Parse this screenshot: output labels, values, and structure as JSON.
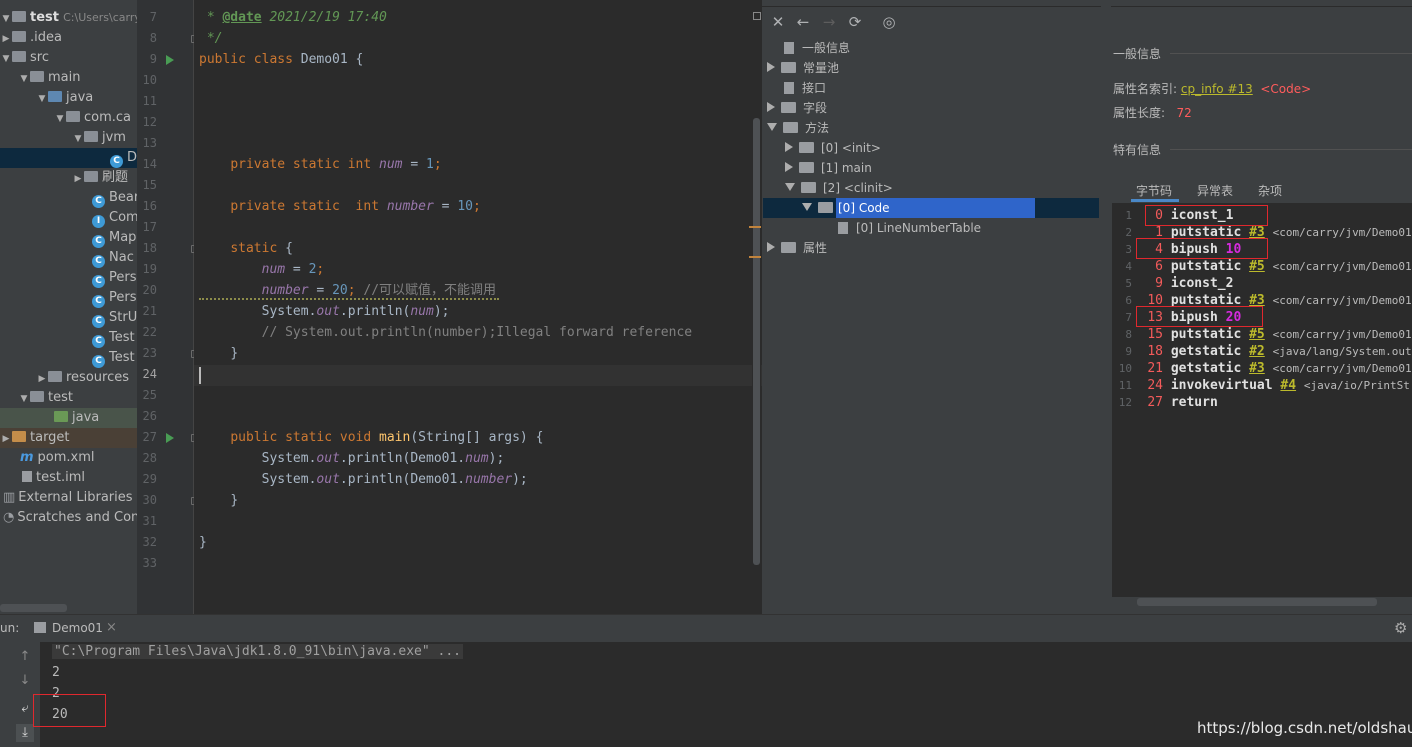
{
  "project": {
    "root_name": "test",
    "root_path": "C:\\Users\\carry.",
    "items": [
      {
        "label": ".idea"
      },
      {
        "label": "src"
      },
      {
        "label": "main"
      },
      {
        "label": "java"
      },
      {
        "label": "com.ca"
      },
      {
        "label": "jvm"
      },
      {
        "label": "D"
      },
      {
        "label": "刷题"
      },
      {
        "label": "Bear"
      },
      {
        "label": "Com"
      },
      {
        "label": "Map"
      },
      {
        "label": "Nac"
      },
      {
        "label": "Pers"
      },
      {
        "label": "Pers"
      },
      {
        "label": "StrU"
      },
      {
        "label": "Test"
      },
      {
        "label": "Test"
      },
      {
        "label": "resources"
      },
      {
        "label": "test"
      },
      {
        "label": "java"
      },
      {
        "label": "target"
      },
      {
        "label": "pom.xml"
      },
      {
        "label": "test.iml"
      },
      {
        "label": "External Libraries"
      },
      {
        "label": "Scratches and Cons"
      }
    ]
  },
  "editor": {
    "line_numbers": [
      "7",
      "8",
      "9",
      "10",
      "11",
      "12",
      "13",
      "14",
      "15",
      "16",
      "17",
      "18",
      "19",
      "20",
      "21",
      "22",
      "23",
      "24",
      "25",
      "26",
      "27",
      "28",
      "29",
      "30",
      "31",
      "32",
      "33"
    ],
    "doc_line1_prefix": " * ",
    "doc_tag": "@date",
    "doc_line1_rest": " 2021/2/19 17:40",
    "doc_line2": " */",
    "class_kw": "public class ",
    "class_name": "Demo01 {",
    "l14_kw": "private static int ",
    "l14_field": "num",
    "l14_eq": " = ",
    "l14_num": "1",
    "l14_end": ";",
    "l16_kw": "private static  int ",
    "l16_field": "number",
    "l16_eq": " = ",
    "l16_num": "10",
    "l16_end": ";",
    "l18_kw": "static",
    "l18_rest": " {",
    "l19_field": "num",
    "l19_eq": " = ",
    "l19_num": "2",
    "l19_end": ";",
    "l20_field": "number",
    "l20_eq": " = ",
    "l20_num": "20",
    "l20_end": "; ",
    "l20_comment": "//可以赋值，不能调用",
    "l21_a": "System.",
    "l21_out": "out",
    "l21_b": ".println(",
    "l21_field": "num",
    "l21_c": ");",
    "l22_comment": "// System.out.println(number);Illegal forward reference",
    "l23": "}",
    "l27_kw": "public static void ",
    "l27_fn": "main",
    "l27_rest": "(String[] args) {",
    "l28_a": "System.",
    "l28_out": "out",
    "l28_b": ".println(Demo01.",
    "l28_field": "num",
    "l28_c": ");",
    "l29_a": "System.",
    "l29_out": "out",
    "l29_b": ".println(Demo01.",
    "l29_field": "number",
    "l29_c": ");",
    "l30": "}",
    "l32": "}"
  },
  "bytecode_viewer": {
    "toolbar": {
      "close": "✕",
      "back": "←",
      "forward": "→",
      "refresh": "⟳",
      "web": "◎"
    },
    "tree": [
      {
        "label": "一般信息"
      },
      {
        "label": "常量池"
      },
      {
        "label": "接口"
      },
      {
        "label": "字段"
      },
      {
        "label": "方法"
      },
      {
        "label": "[0] <init>"
      },
      {
        "label": "[1] main"
      },
      {
        "label": "[2] <clinit>"
      },
      {
        "label": "[0] Code"
      },
      {
        "label": "[0] LineNumberTable"
      },
      {
        "label": "属性"
      }
    ],
    "general_title": "一般信息",
    "attr_name_label": "属性名索引:",
    "attr_name_link": "cp_info #13",
    "attr_name_value": "<Code>",
    "attr_len_label": "属性长度:",
    "attr_len_value": "72",
    "specific_title": "特有信息",
    "tabs": [
      "字节码",
      "异常表",
      "杂项"
    ],
    "code_lines": [
      {
        "n": "1",
        "offset": "0",
        "op": "iconst_1",
        "ref": "",
        "lit": "",
        "comment": ""
      },
      {
        "n": "2",
        "offset": "1",
        "op": "putstatic",
        "ref": "#3",
        "lit": "",
        "comment": "<com/carry/jvm/Demo01"
      },
      {
        "n": "3",
        "offset": "4",
        "op": "bipush",
        "ref": "",
        "lit": "10",
        "comment": ""
      },
      {
        "n": "4",
        "offset": "6",
        "op": "putstatic",
        "ref": "#5",
        "lit": "",
        "comment": "<com/carry/jvm/Demo01"
      },
      {
        "n": "5",
        "offset": "9",
        "op": "iconst_2",
        "ref": "",
        "lit": "",
        "comment": ""
      },
      {
        "n": "6",
        "offset": "10",
        "op": "putstatic",
        "ref": "#3",
        "lit": "",
        "comment": "<com/carry/jvm/Demo01"
      },
      {
        "n": "7",
        "offset": "13",
        "op": "bipush",
        "ref": "",
        "lit": "20",
        "comment": ""
      },
      {
        "n": "8",
        "offset": "15",
        "op": "putstatic",
        "ref": "#5",
        "lit": "",
        "comment": "<com/carry/jvm/Demo01"
      },
      {
        "n": "9",
        "offset": "18",
        "op": "getstatic",
        "ref": "#2",
        "lit": "",
        "comment": "<java/lang/System.out"
      },
      {
        "n": "10",
        "offset": "21",
        "op": "getstatic",
        "ref": "#3",
        "lit": "",
        "comment": "<com/carry/jvm/Demo01"
      },
      {
        "n": "11",
        "offset": "24",
        "op": "invokevirtual",
        "ref": "#4",
        "lit": "",
        "comment": "<java/io/PrintSt"
      },
      {
        "n": "12",
        "offset": "27",
        "op": "return",
        "ref": "",
        "lit": "",
        "comment": ""
      }
    ]
  },
  "run": {
    "label": "un:",
    "tab_name": "Demo01",
    "tab_close": "×",
    "cmd": "\"C:\\Program Files\\Java\\jdk1.8.0_91\\bin\\java.exe\" ...",
    "output": [
      "2",
      "2",
      "20"
    ]
  },
  "watermark": "https://blog.csdn.net/oldshaui",
  "colors": {
    "selection": "#2f65ca",
    "highlight_box": "#e0282e",
    "keyword": "#cc7832",
    "field": "#9876aa"
  }
}
